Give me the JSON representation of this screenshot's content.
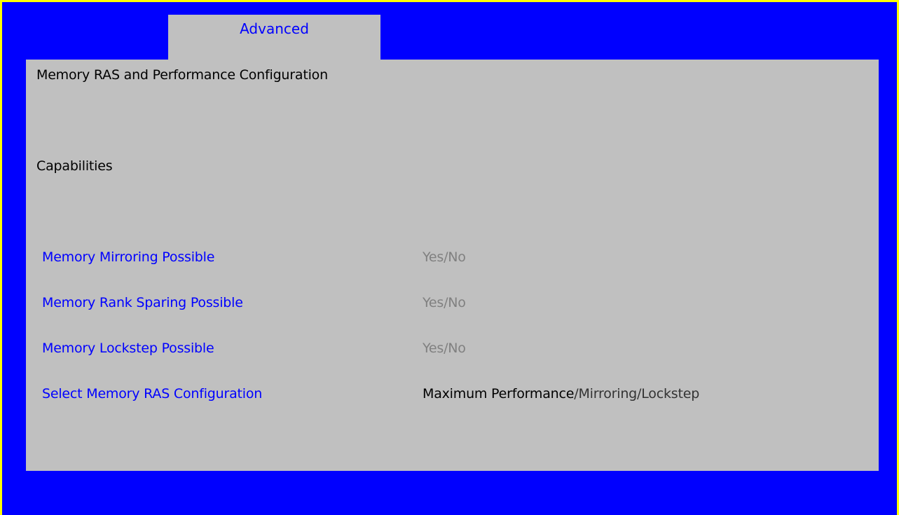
{
  "tab": {
    "label": "Advanced"
  },
  "page": {
    "title": "Memory RAS and Performance Configuration",
    "section": "Capabilities"
  },
  "rows": [
    {
      "label": "Memory Mirroring Possible",
      "value": "Yes/No"
    },
    {
      "label": "Memory Rank Sparing Possible",
      "value": "Yes/No"
    },
    {
      "label": "Memory Lockstep Possible",
      "value": "Yes/No"
    }
  ],
  "ras_config": {
    "label": "Select Memory RAS Configuration",
    "selected_option": "Maximum Performance",
    "other_options": "/Mirroring/Lockstep"
  },
  "colors": {
    "outer_border": "#ffff00",
    "background": "#0000ff",
    "panel": "#c0c0c0",
    "label_text": "#0000ff",
    "disabled_value": "#808080",
    "selected_value": "#000000"
  }
}
